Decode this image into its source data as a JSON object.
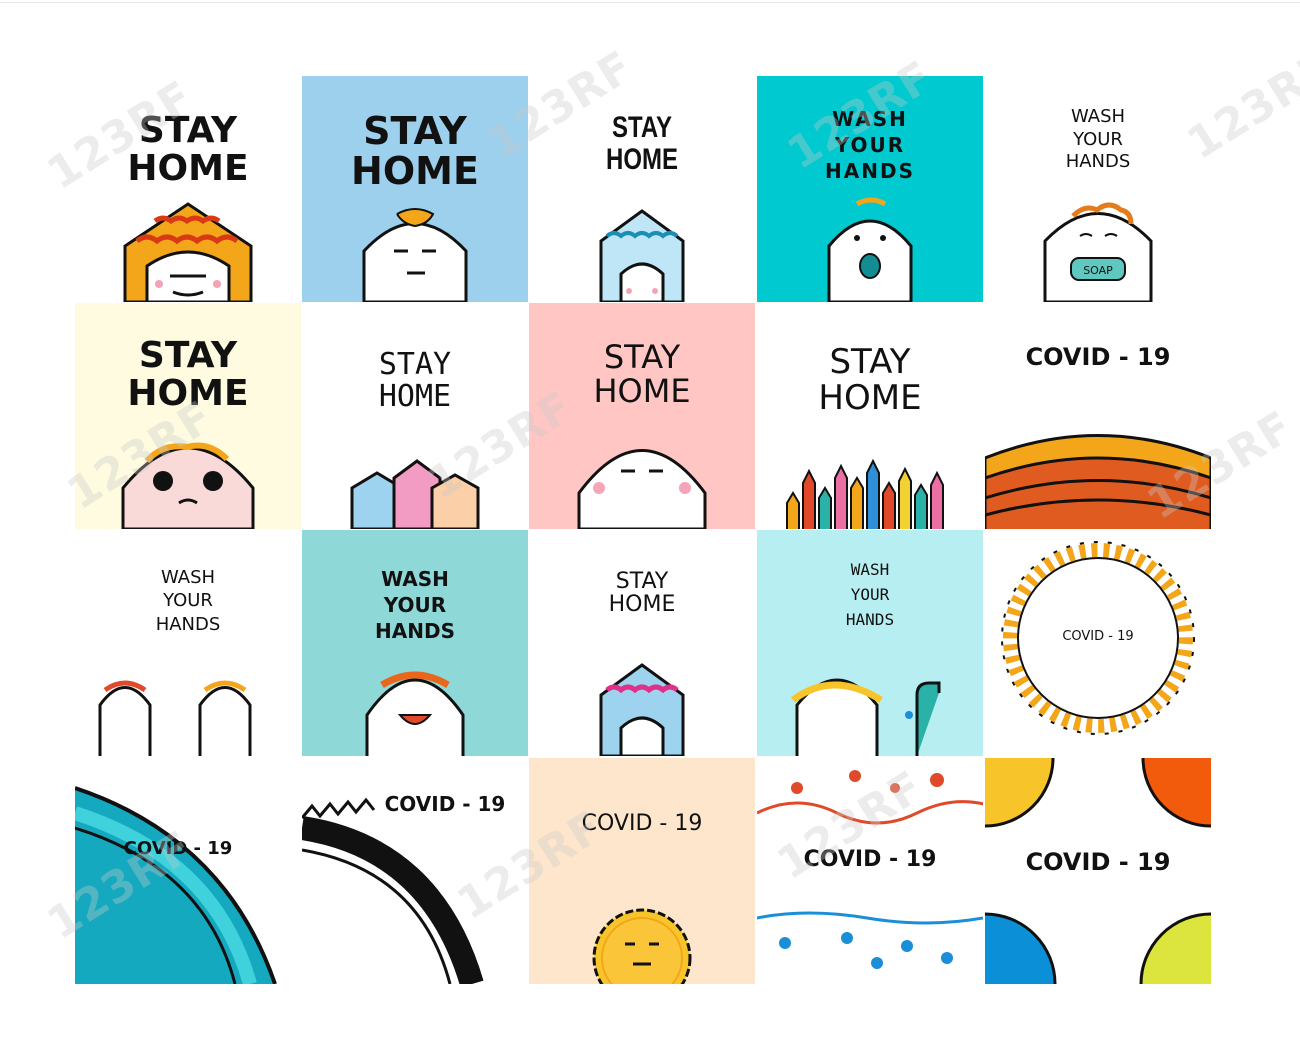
{
  "tiles": [
    {
      "id": "t1",
      "lines": [
        "STAY",
        "HOME"
      ]
    },
    {
      "id": "t2",
      "lines": [
        "STAY",
        "HOME"
      ]
    },
    {
      "id": "t3",
      "lines": [
        "STAY",
        "HOME"
      ]
    },
    {
      "id": "t4",
      "lines": [
        "WASH",
        "YOUR",
        "HANDS"
      ]
    },
    {
      "id": "t5",
      "lines": [
        "WASH",
        "YOUR",
        "HANDS"
      ]
    },
    {
      "id": "t6",
      "lines": [
        "STAY",
        "HOME"
      ]
    },
    {
      "id": "t7",
      "lines": [
        "STAY",
        "HOME"
      ]
    },
    {
      "id": "t8",
      "lines": [
        "STAY",
        "HOME"
      ]
    },
    {
      "id": "t9",
      "lines": [
        "STAY",
        "HOME"
      ]
    },
    {
      "id": "t10",
      "lines": [
        "COVID - 19"
      ]
    },
    {
      "id": "t11",
      "lines": [
        "WASH",
        "YOUR",
        "HANDS"
      ]
    },
    {
      "id": "t12",
      "lines": [
        "WASH",
        "YOUR",
        "HANDS"
      ]
    },
    {
      "id": "t13",
      "lines": [
        "STAY",
        "HOME"
      ]
    },
    {
      "id": "t14",
      "lines": [
        "WASH",
        "YOUR",
        "HANDS"
      ]
    },
    {
      "id": "t15",
      "lines": [
        "COVID - 19"
      ]
    },
    {
      "id": "t16",
      "lines": [
        "COVID - 19"
      ]
    },
    {
      "id": "t17",
      "lines": [
        "COVID - 19"
      ]
    },
    {
      "id": "t18",
      "lines": [
        "COVID - 19"
      ]
    },
    {
      "id": "t19",
      "lines": [
        "COVID - 19"
      ]
    },
    {
      "id": "t20",
      "lines": [
        "COVID - 19"
      ]
    }
  ],
  "soap_label": "SOAP",
  "watermark": "123RF",
  "colors": {
    "blue": "#9dd0ec",
    "teal": "#00c9cf",
    "cream": "#fefbe0",
    "pink": "#ffc6c4",
    "aqua": "#8fd8d8",
    "skyaqua": "#b7eef2",
    "peach": "#fde6cc",
    "ocean": "#14a9bf"
  }
}
